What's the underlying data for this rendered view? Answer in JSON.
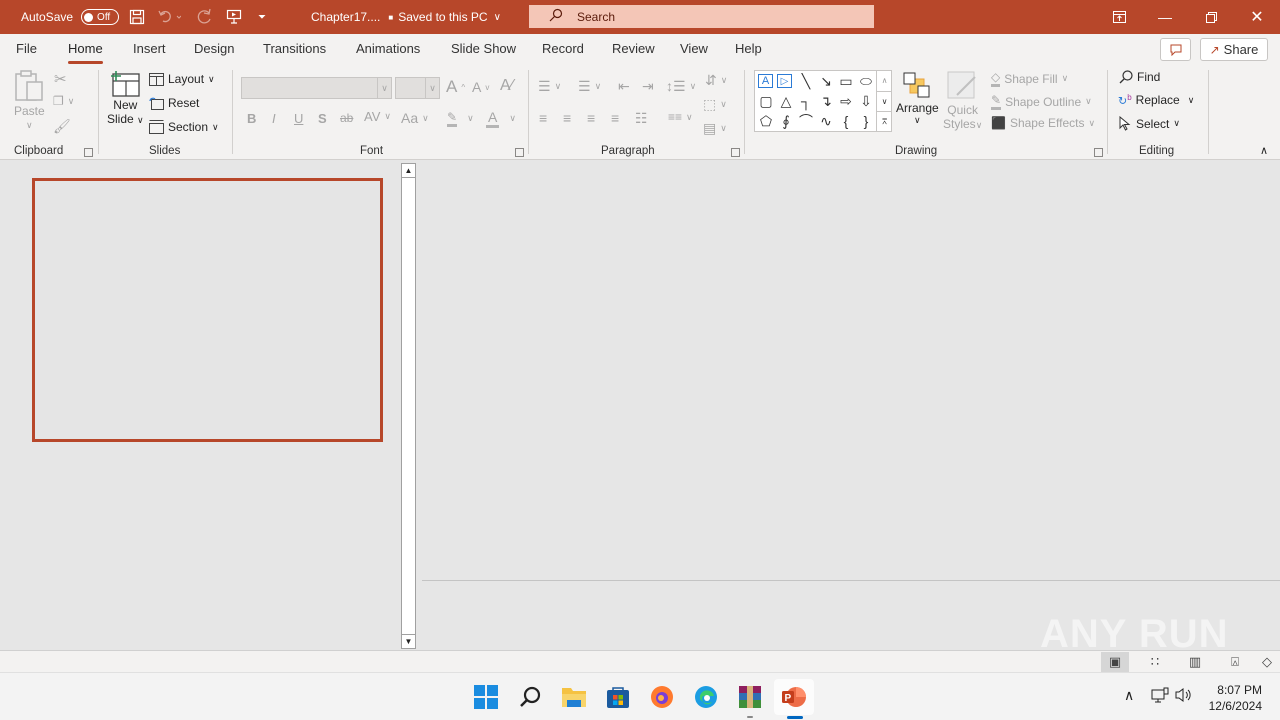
{
  "titlebar": {
    "autosave_label": "AutoSave",
    "autosave_state": "Off",
    "doc_name": "Chapter17....",
    "save_status": "Saved to this PC",
    "search_placeholder": "Search",
    "icons": [
      "save-icon",
      "undo-icon",
      "redo-icon",
      "present-from-start-icon",
      "customize-qat-icon"
    ],
    "window_buttons": [
      "ribbon-display-options",
      "minimize",
      "restore",
      "close"
    ]
  },
  "tabs": [
    "File",
    "Home",
    "Insert",
    "Design",
    "Transitions",
    "Animations",
    "Slide Show",
    "Record",
    "Review",
    "View",
    "Help"
  ],
  "active_tab": "Home",
  "top_right": {
    "share_label": "Share"
  },
  "ribbon": {
    "clipboard": {
      "label": "Clipboard",
      "paste": "Paste"
    },
    "slides": {
      "label": "Slides",
      "new_slide_1": "New",
      "new_slide_2": "Slide",
      "layout": "Layout",
      "reset": "Reset",
      "section": "Section"
    },
    "font": {
      "label": "Font",
      "font_name": "",
      "font_size": "",
      "bold": "B",
      "italic": "I",
      "underline": "U",
      "shadow": "S",
      "strike": "ab",
      "spacing": "AV",
      "case": "Aa",
      "grow": "A",
      "shrink": "A"
    },
    "paragraph": {
      "label": "Paragraph"
    },
    "drawing": {
      "label": "Drawing",
      "arrange": "Arrange",
      "quick_styles_1": "Quick",
      "quick_styles_2": "Styles",
      "shape_fill": "Shape Fill",
      "shape_outline": "Shape Outline",
      "shape_effects": "Shape Effects"
    },
    "editing": {
      "label": "Editing",
      "find": "Find",
      "replace": "Replace",
      "select": "Select"
    }
  },
  "colors": {
    "accent": "#b7472a",
    "search_bg": "#f4c6b7",
    "ribbon_bg": "#f3f2f1",
    "canvas_bg": "#e6e6e6"
  },
  "taskbar": {
    "apps": [
      "windows-start",
      "search",
      "file-explorer",
      "microsoft-store",
      "firefox",
      "edge",
      "winrar",
      "powerpoint"
    ],
    "time": "8:07 PM",
    "date": "12/6/2024"
  },
  "watermark": "ANY RUN"
}
